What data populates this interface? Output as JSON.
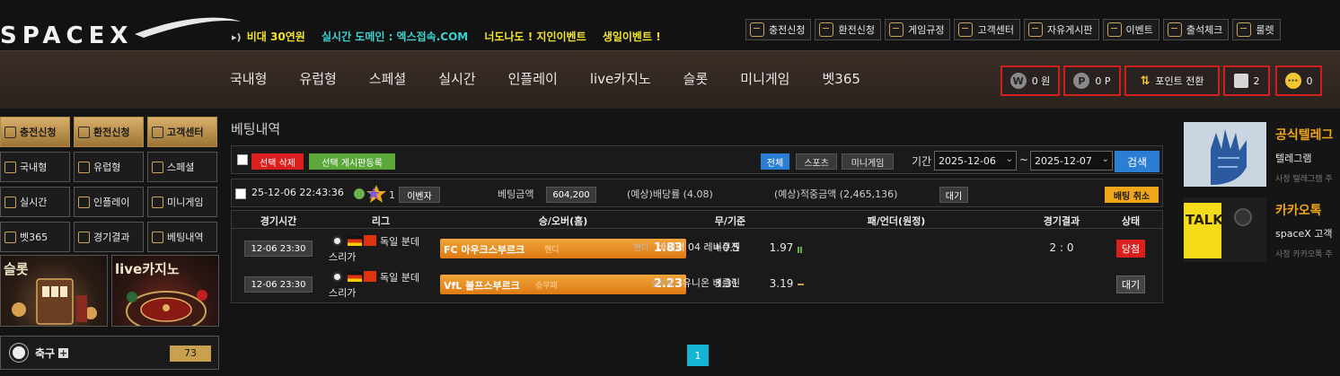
{
  "brand": {
    "logo_text": "SPACEX"
  },
  "marquee": [
    {
      "text": "비대 30연원",
      "tone": "y"
    },
    {
      "text": "실시간 도메인 : 엑스접속.COM",
      "tone": "c"
    },
    {
      "text": "너도나도 ! 지인이벤트",
      "tone": "w"
    },
    {
      "text": "생일이벤트 !",
      "tone": "w"
    }
  ],
  "toplinks": [
    "충전신청",
    "환전신청",
    "게임규정",
    "고객센터",
    "자유게시판",
    "이벤트",
    "출석체크",
    "룰렛"
  ],
  "nav": [
    "국내형",
    "유럽형",
    "스페셜",
    "실시간",
    "인플레이",
    "live카지노",
    "슬롯",
    "미니게임",
    "벳365"
  ],
  "wallet": {
    "money": "0 원",
    "money_icon": "W",
    "point": "0 P",
    "point_icon": "P",
    "convert": "포인트 전환",
    "notes_count": "2",
    "messages_count": "0"
  },
  "side": {
    "gold_buttons": [
      "충전신청",
      "환전신청",
      "고객센터"
    ],
    "buttons": [
      "국내형",
      "유럽형",
      "스페셜",
      "실시간",
      "인플레이",
      "미니게임",
      "벳365",
      "경기결과",
      "베팅내역"
    ],
    "promos": [
      "슬롯",
      "live카지노"
    ],
    "sport": {
      "label": "축구",
      "count": "73"
    }
  },
  "main": {
    "title": "베팅내역",
    "delete_selected": "선택 삭제",
    "post_selected": "선택 게시판등록",
    "filters": [
      "전체",
      "스포츠",
      "미니게임"
    ],
    "period_label": "기간",
    "date_from": "2025-12-06",
    "date_to": "2025-12-07",
    "tilde": "~",
    "search": "검색"
  },
  "slip": {
    "datetime": "25-12-06 22:43:36",
    "badge": "1",
    "game_type": "이벤자",
    "stake_label": "베팅금액",
    "stake": "604,200",
    "odds_text": "(예상)배당률 (4.08)",
    "payout_text": "(예상)적중금액 (2,465,136)",
    "state": "대기",
    "cancel": "배팅 취소"
  },
  "table": {
    "headers": [
      "경기시간",
      "리그",
      "승/오버(홈)",
      "무/기준",
      "패/언더(원정)",
      "경기결과",
      "상태"
    ],
    "rows": [
      {
        "time": "12-06 23:30",
        "league": "독일 분데",
        "league2": "스리가",
        "home": "FC 아우크스부르크",
        "pick_label": "핸디",
        "home_odds": "1.83",
        "line": "+0.5",
        "away_odds": "1.97",
        "away_label": "핸디",
        "away": "바이어 04 레버쿠젠",
        "result": "2 : 0",
        "status": "당첨",
        "status_tone": "red"
      },
      {
        "time": "12-06 23:30",
        "league": "독일 분데",
        "league2": "스리가",
        "home": "VfL 볼프스부르크",
        "pick_label": "승무패",
        "home_odds": "2.23",
        "line": "3.31",
        "away_odds": "3.19",
        "away_label": "승무패",
        "away": "유니온 베를린",
        "result": "",
        "status": "대기",
        "status_tone": "grey"
      }
    ]
  },
  "pagination": {
    "current": "1"
  },
  "ads": [
    {
      "title": "공식텔레그",
      "line2": "텔레그램",
      "line3": "사정 텔레그램 주"
    },
    {
      "title": "카카오톡 ",
      "line2": "spaceX 고객",
      "line3": "사정 카카오톡 주",
      "thumb_text": "TALK"
    }
  ]
}
